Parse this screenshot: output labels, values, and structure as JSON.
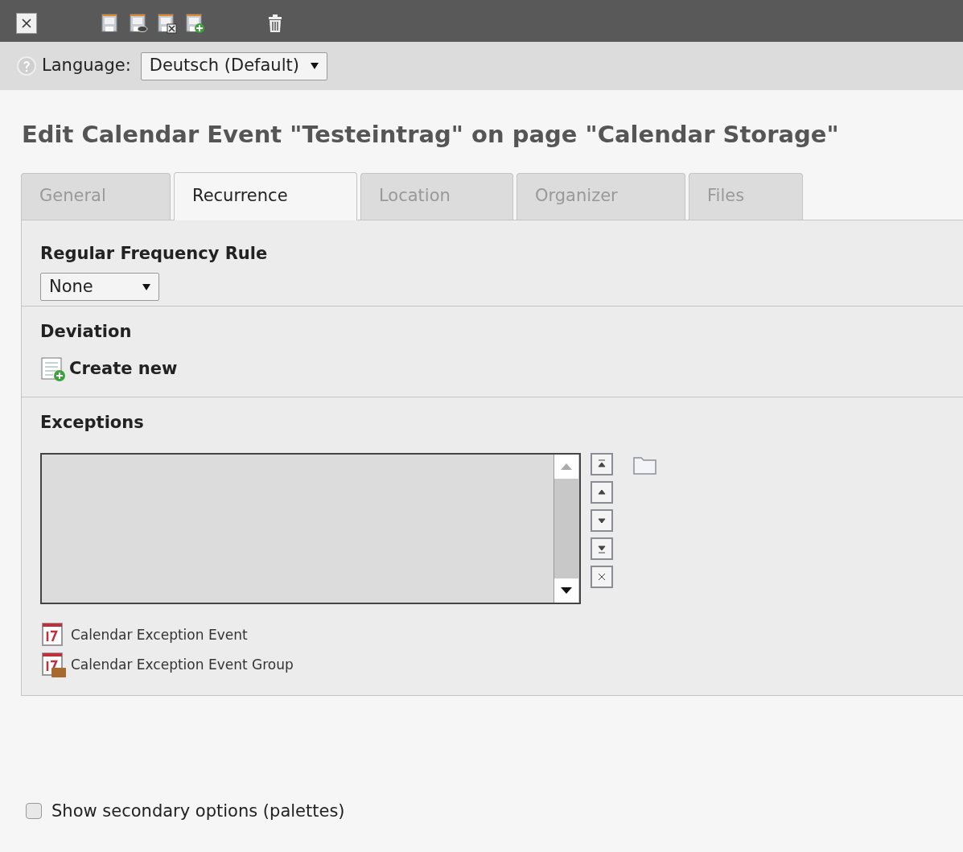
{
  "toolbar": {
    "buttons": [
      {
        "kind": "close"
      },
      {
        "kind": "save"
      },
      {
        "kind": "save-view"
      },
      {
        "kind": "save-close"
      },
      {
        "kind": "save-new"
      },
      {
        "kind": "delete"
      }
    ]
  },
  "language_bar": {
    "label": "Language:",
    "value": "Deutsch (Default)"
  },
  "title": "Edit Calendar Event \"Testeintrag\" on page \"Calendar Storage\"",
  "tabs": [
    {
      "label": "General",
      "selected": false
    },
    {
      "label": "Recurrence",
      "selected": true
    },
    {
      "label": "Location",
      "selected": false
    },
    {
      "label": "Organizer",
      "selected": false
    },
    {
      "label": "Files",
      "selected": false
    }
  ],
  "frequency_rule": {
    "label": "Regular Frequency Rule",
    "value": "None"
  },
  "deviation": {
    "label": "Deviation",
    "create_new": "Create new"
  },
  "exceptions": {
    "label": "Exceptions",
    "tables": [
      {
        "label": "Calendar Exception Event",
        "kind": "event"
      },
      {
        "label": "Calendar Exception Event Group",
        "kind": "group"
      }
    ]
  },
  "secondary_options": {
    "label": "Show secondary options (palettes)",
    "checked": false
  }
}
